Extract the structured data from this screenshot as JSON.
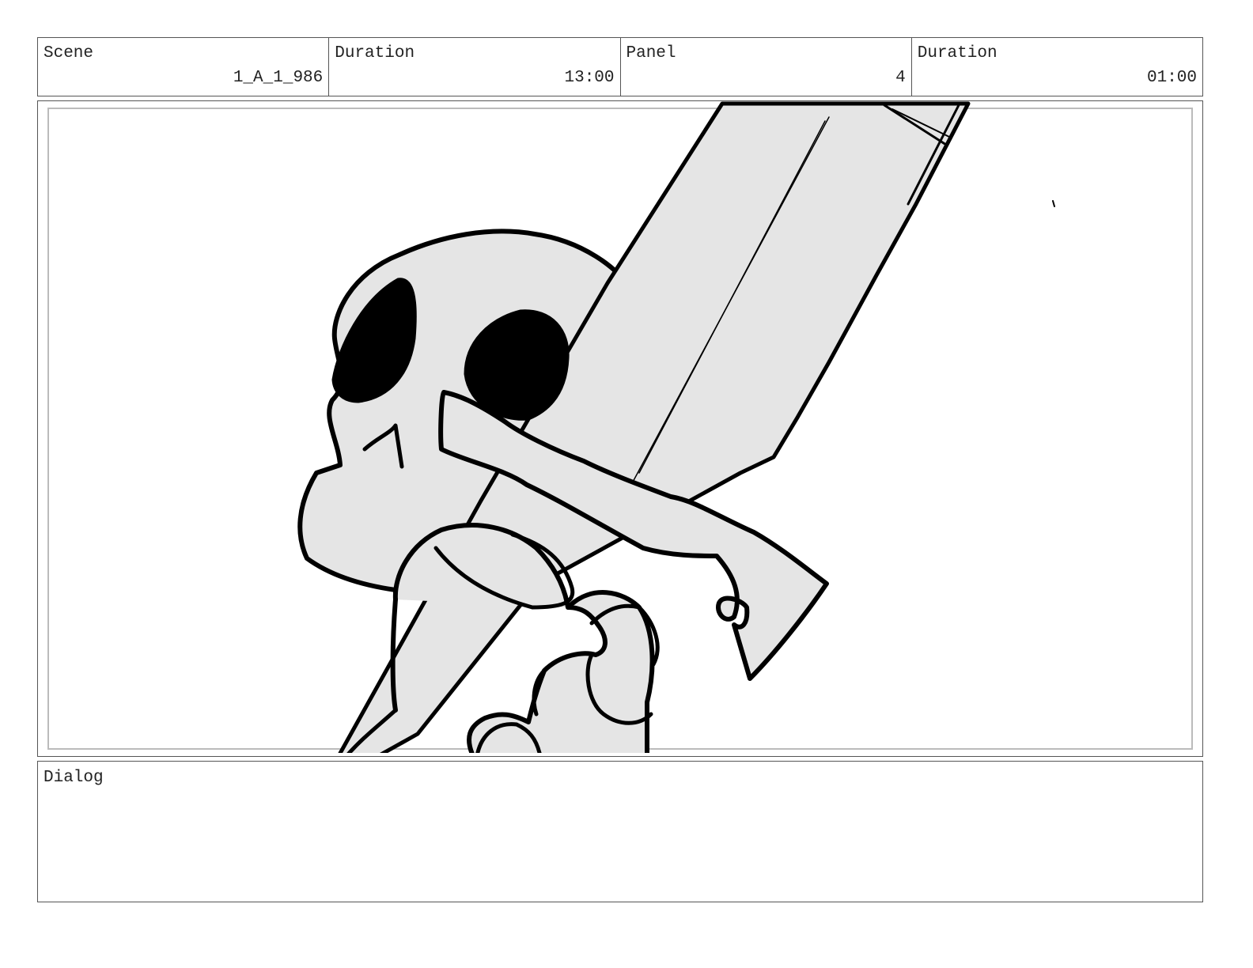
{
  "header": {
    "scene": {
      "label": "Scene",
      "value": "1_A_1_986"
    },
    "scene_duration": {
      "label": "Duration",
      "value": "13:00"
    },
    "panel": {
      "label": "Panel",
      "value": "4"
    },
    "panel_duration": {
      "label": "Duration",
      "value": "01:00"
    }
  },
  "dialog": {
    "label": "Dialog",
    "text": ""
  },
  "colors": {
    "border": "#555555",
    "inner_border": "#bbbbbb",
    "fill_gray": "#e5e5e5",
    "ink": "#000000"
  },
  "artwork": {
    "icon": "skull-holding-sword-sketch"
  }
}
